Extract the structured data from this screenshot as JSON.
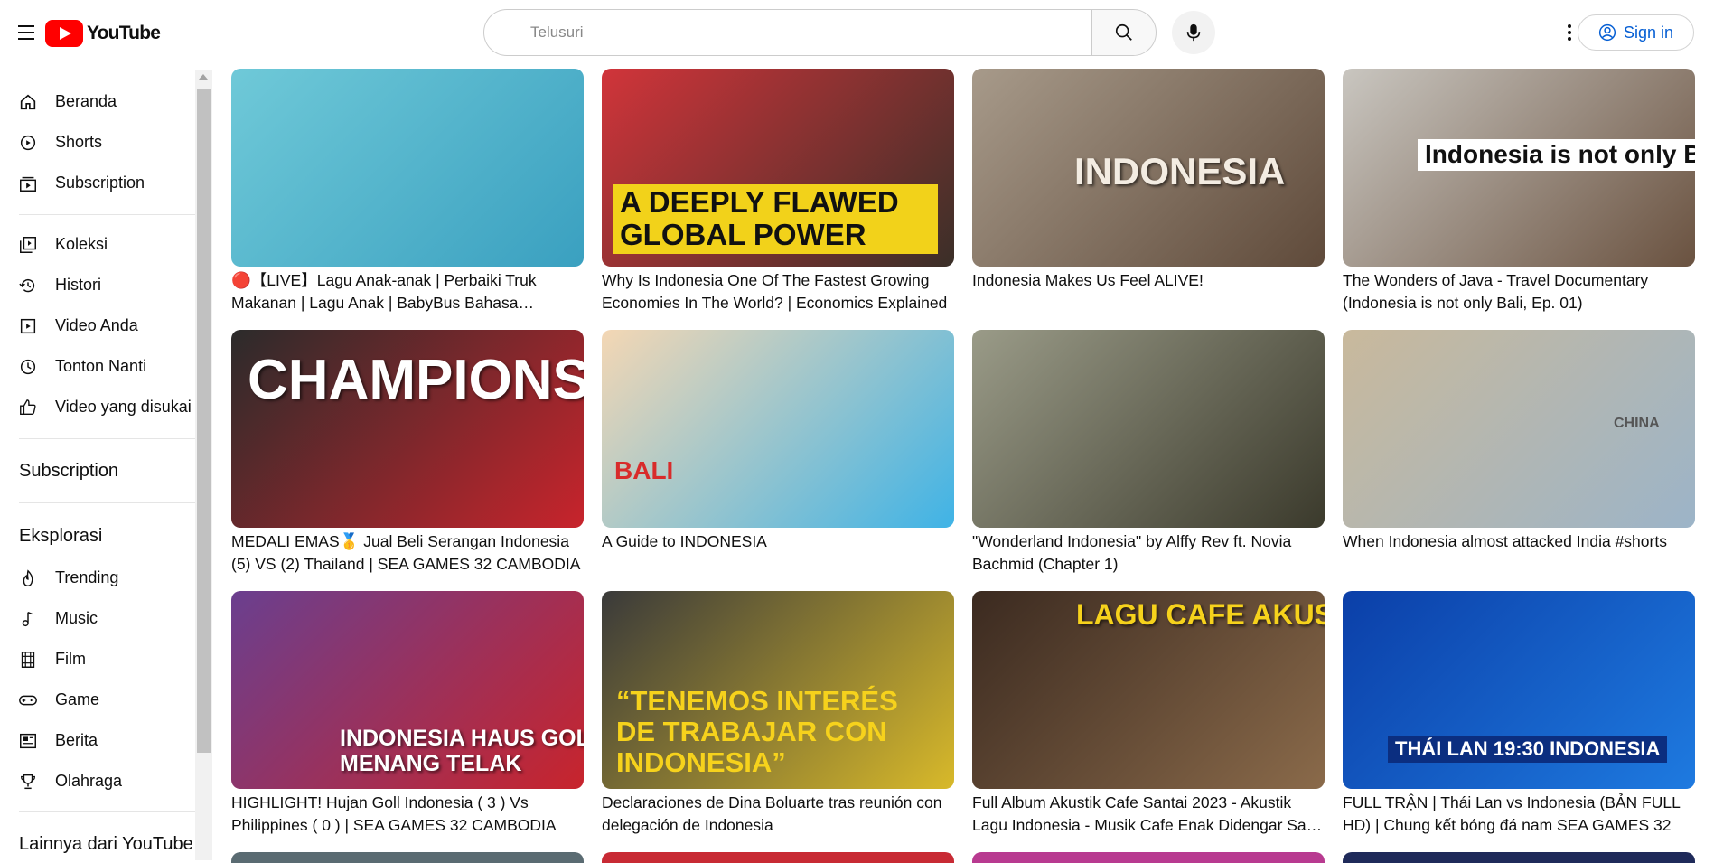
{
  "header": {
    "logo_text": "YouTube",
    "search_placeholder": "Telusuri",
    "sign_in_label": "Sign in"
  },
  "sidebar": {
    "main": [
      {
        "label": "Beranda",
        "icon": "home-icon"
      },
      {
        "label": "Shorts",
        "icon": "shorts-icon"
      },
      {
        "label": "Subscription",
        "icon": "subscriptions-icon"
      }
    ],
    "library": [
      {
        "label": "Koleksi",
        "icon": "library-icon"
      },
      {
        "label": "Histori",
        "icon": "history-icon"
      },
      {
        "label": "Video Anda",
        "icon": "your-videos-icon"
      },
      {
        "label": "Tonton Nanti",
        "icon": "watch-later-icon"
      },
      {
        "label": "Video yang disukai",
        "icon": "liked-icon"
      }
    ],
    "subscription_heading": "Subscription",
    "explore_heading": "Eksplorasi",
    "explore": [
      {
        "label": "Trending",
        "icon": "trending-icon"
      },
      {
        "label": "Music",
        "icon": "music-icon"
      },
      {
        "label": "Film",
        "icon": "film-icon"
      },
      {
        "label": "Game",
        "icon": "game-icon"
      },
      {
        "label": "Berita",
        "icon": "news-icon"
      },
      {
        "label": "Olahraga",
        "icon": "sports-icon"
      }
    ],
    "more_heading": "Lainnya dari YouTube"
  },
  "videos": [
    {
      "title": "🔴【LIVE】Lagu Anak-anak | Perbaiki Truk Makanan | Lagu Anak | BabyBus Bahasa Indonesia",
      "thumb_text": "",
      "colors": [
        "#6fc9d8",
        "#3aa0c0"
      ]
    },
    {
      "title": "Why Is Indonesia One Of The Fastest Growing Economies In The World? | Economics Explained",
      "thumb_text": "A DEEPLY FLAWED GLOBAL POWER",
      "colors": [
        "#d1343a",
        "#3a2f28"
      ]
    },
    {
      "title": "Indonesia Makes Us Feel ALIVE!",
      "thumb_text": "INDONESIA",
      "colors": [
        "#a79a8a",
        "#5f4a3a"
      ]
    },
    {
      "title": "The Wonders of Java - Travel Documentary (Indonesia is not only Bali, Ep. 01)",
      "thumb_text": "Indonesia is not only Bali",
      "colors": [
        "#c9c6c0",
        "#6a5240"
      ]
    },
    {
      "title": "MEDALI EMAS🥇 Jual Beli Serangan Indonesia (5) VS (2) Thailand | SEA GAMES 32 CAMBODIA",
      "thumb_text": "CHAMPIONS!!!",
      "colors": [
        "#2b2b2b",
        "#c8242c"
      ]
    },
    {
      "title": "A Guide to INDONESIA",
      "thumb_text": "BALI",
      "colors": [
        "#f4d7b4",
        "#3fb3e6"
      ]
    },
    {
      "title": "\"Wonderland Indonesia\" by Alffy Rev ft. Novia Bachmid (Chapter 1)",
      "thumb_text": "",
      "colors": [
        "#9a9b88",
        "#3b3a2c"
      ]
    },
    {
      "title": "When Indonesia almost attacked India #shorts",
      "thumb_text": "CHINA",
      "colors": [
        "#c9b99c",
        "#9cb4c8"
      ]
    },
    {
      "title": "HIGHLIGHT! Hujan Goll Indonesia ( 3 ) Vs Philippines ( 0 ) | SEA GAMES 32 CAMBODIA",
      "thumb_text": "INDONESIA HAUS GOL! MENANG TELAK",
      "colors": [
        "#6a3f8f",
        "#c8242c"
      ]
    },
    {
      "title": "Declaraciones de Dina Boluarte tras reunión con delegación de Indonesia",
      "thumb_text": "“TENEMOS INTERÉS DE TRABAJAR CON INDONESIA”",
      "colors": [
        "#3a3a3a",
        "#d8b92a"
      ]
    },
    {
      "title": "Full Album Akustik Cafe Santai 2023 - Akustik Lagu Indonesia - Musik Cafe Enak Didengar Saat Santai",
      "thumb_text": "LAGU CAFE AKUSTIK",
      "colors": [
        "#3b2a20",
        "#8a6a4a"
      ]
    },
    {
      "title": "FULL TRẬN | Thái Lan vs Indonesia (BẢN FULL HD) | Chung kết bóng đá nam SEA GAMES 32",
      "thumb_text": "THÁI LAN 19:30 INDONESIA",
      "colors": [
        "#0b3fa8",
        "#1e7ae0"
      ]
    }
  ]
}
